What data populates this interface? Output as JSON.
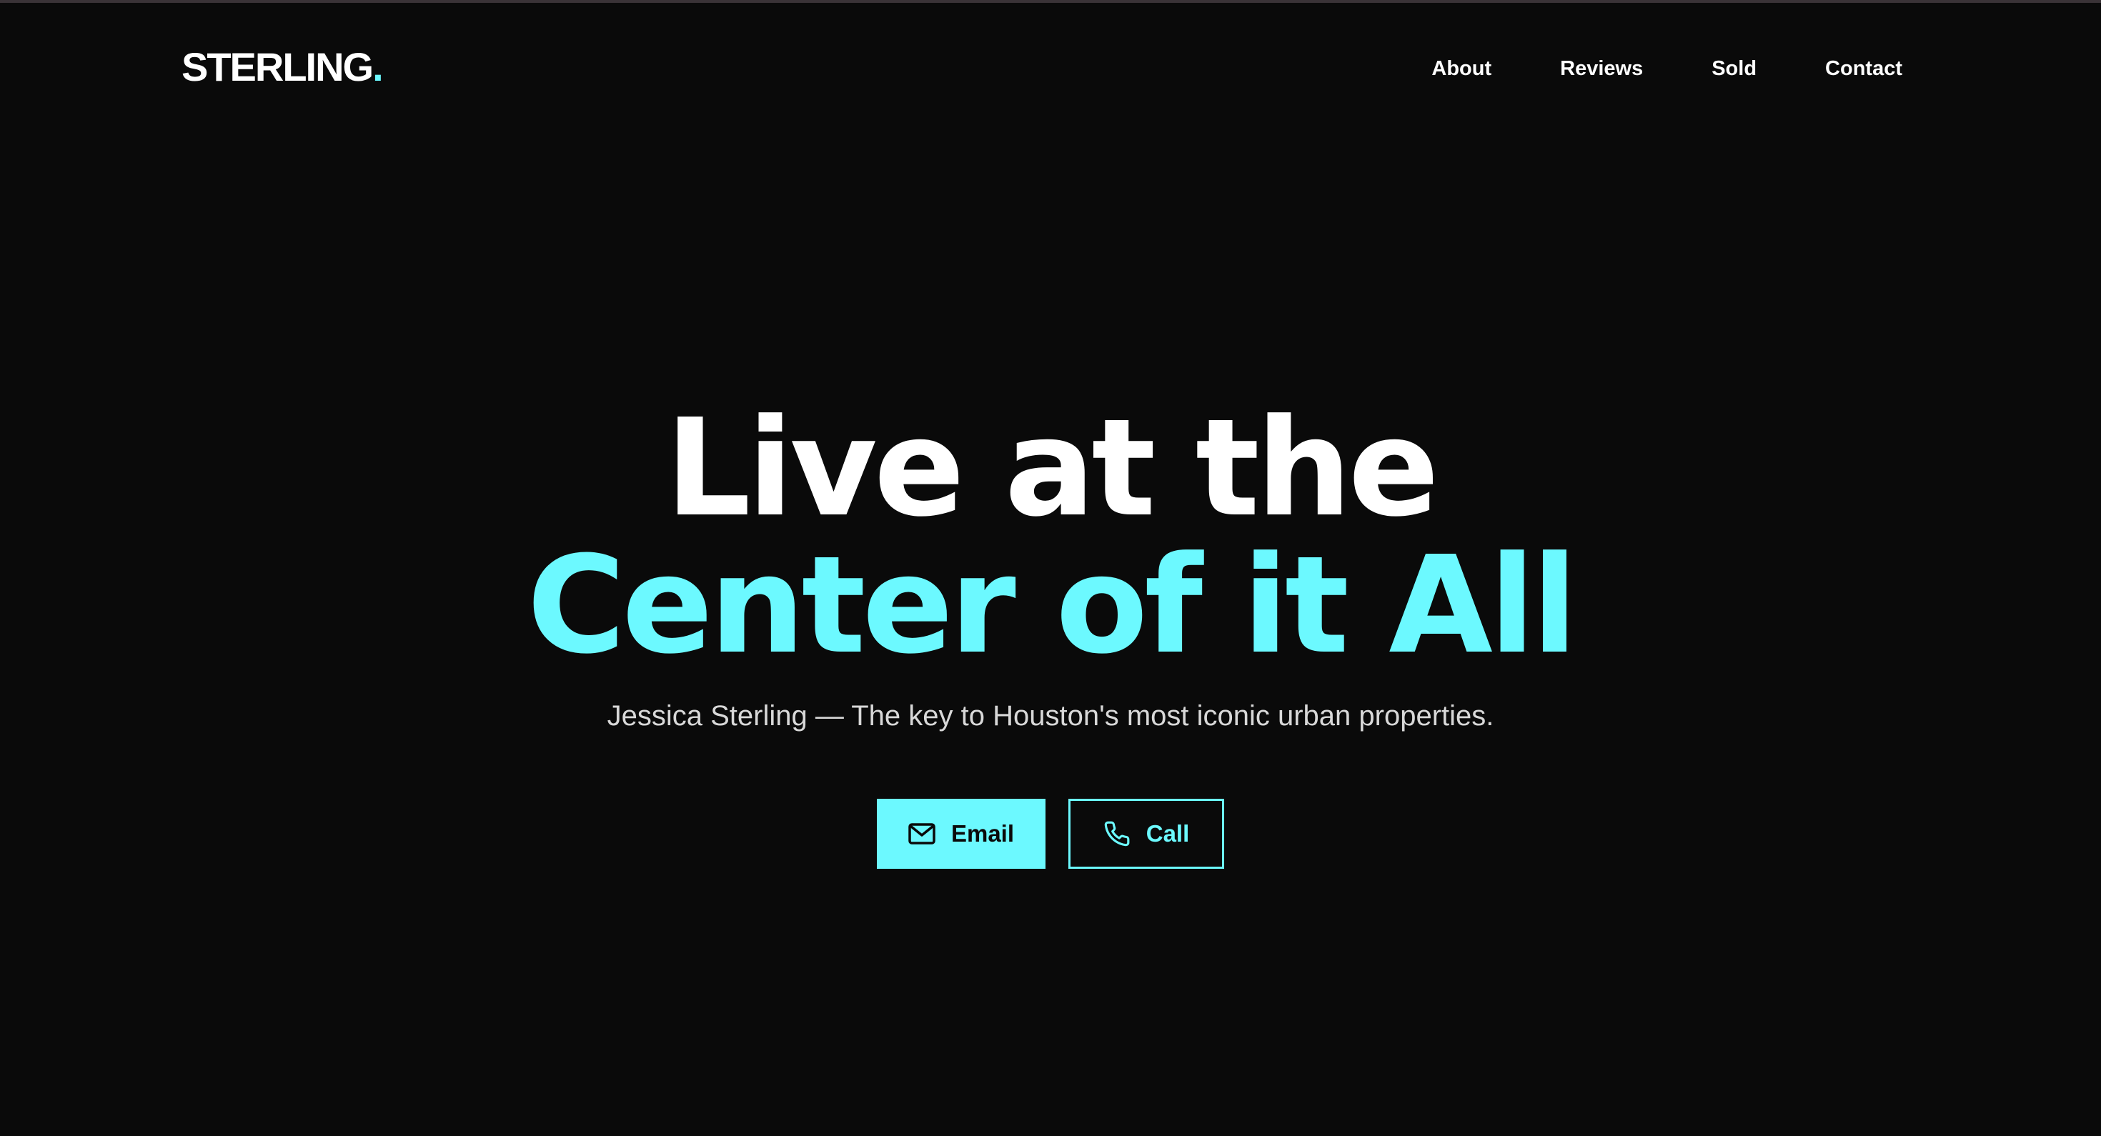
{
  "header": {
    "logo_text": "STERLING",
    "logo_dot": ".",
    "nav": [
      {
        "label": "About"
      },
      {
        "label": "Reviews"
      },
      {
        "label": "Sold"
      },
      {
        "label": "Contact"
      }
    ]
  },
  "hero": {
    "headline_line1": "Live at the",
    "headline_line2": "Center of it All",
    "subtitle": "Jessica Sterling — The key to Houston's most iconic urban properties."
  },
  "cta": {
    "email_label": "Email",
    "email_icon": "mail-icon",
    "call_label": "Call",
    "call_icon": "phone-icon"
  },
  "colors": {
    "background": "#0a0a0a",
    "accent": "#6cf9ff",
    "text": "#ffffff"
  }
}
